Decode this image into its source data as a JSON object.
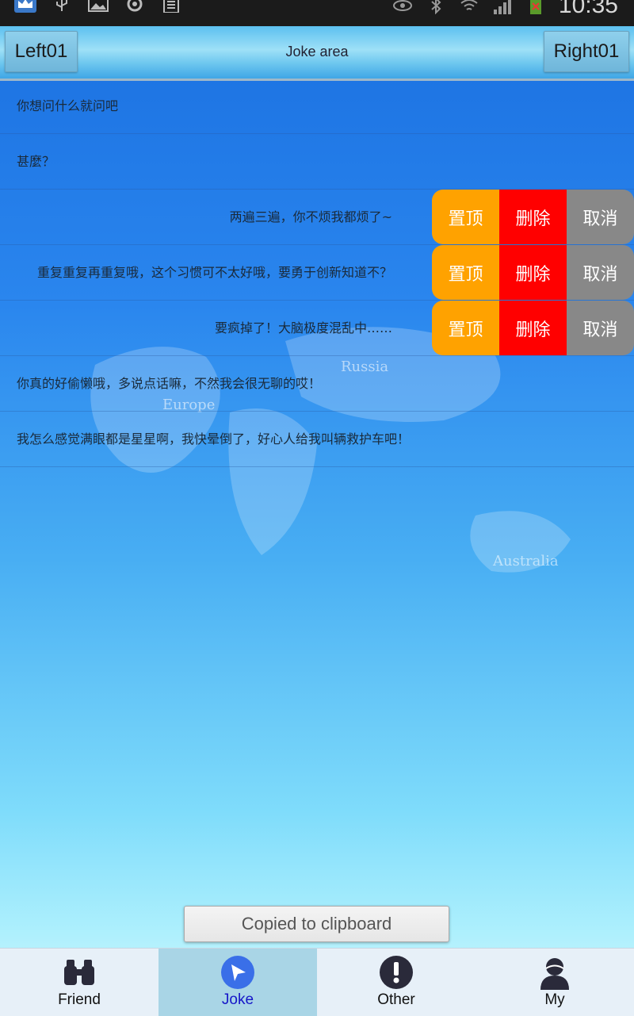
{
  "status_bar": {
    "time": "10:35",
    "icons": [
      "crown-icon",
      "usb-icon",
      "image-icon",
      "settings-icon",
      "clipboard-icon",
      "eye-icon",
      "bluetooth-icon",
      "wifi-icon",
      "signal-icon",
      "battery-icon"
    ]
  },
  "header": {
    "left_button": "Left01",
    "title": "Joke area",
    "right_button": "Right01"
  },
  "background_labels": [
    "Russia",
    "Europe",
    "Australia"
  ],
  "list": {
    "rows": [
      {
        "text": "你想问什么就问吧",
        "swiped": false
      },
      {
        "text": "甚麼？",
        "swiped": false
      },
      {
        "text": "两遍三遍，你不烦我都烦了~",
        "swiped": true
      },
      {
        "text": "重复重复再重复哦，这个习惯可不太好哦，要勇于创新知道不？",
        "swiped": true
      },
      {
        "text": "要疯掉了！大脑极度混乱中……",
        "swiped": true
      },
      {
        "text": "你真的好偷懒哦，多说点话嘛，不然我会很无聊的哎！",
        "swiped": false
      },
      {
        "text": "我怎么感觉满眼都是星星啊，我快晕倒了，好心人给我叫辆救护车吧！",
        "swiped": false
      }
    ],
    "actions": {
      "pin": "置顶",
      "delete": "删除",
      "cancel": "取消"
    },
    "action_colors": {
      "pin": "#ffa200",
      "delete": "#ff0000",
      "cancel": "#888888"
    }
  },
  "toast": "Copied to clipboard",
  "tabs": [
    {
      "label": "Friend",
      "icon": "binoculars-icon",
      "active": false
    },
    {
      "label": "Joke",
      "icon": "navigation-arrow-icon",
      "active": true
    },
    {
      "label": "Other",
      "icon": "exclamation-icon",
      "active": false
    },
    {
      "label": "My",
      "icon": "user-icon",
      "active": false
    }
  ]
}
